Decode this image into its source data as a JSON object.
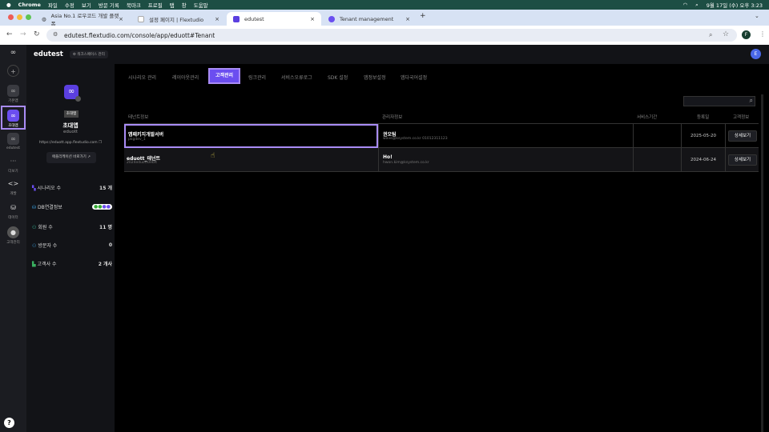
{
  "menubar": {
    "app": "Chrome",
    "items": [
      "파일",
      "수정",
      "보기",
      "방문 기록",
      "북마크",
      "프로필",
      "탭",
      "창",
      "도움말"
    ],
    "clock": "9월 17일 (수) 오후 3:23"
  },
  "tabs": [
    {
      "label": "Asia No.1 로우코드 개발 플랫폼"
    },
    {
      "label": "설정 페이지 | Flextudio"
    },
    {
      "label": "edutest",
      "active": true
    },
    {
      "label": "Tenant management"
    }
  ],
  "address": {
    "url": "edutest.flextudio.com/console/app/eduott#Tenant",
    "profile": "F"
  },
  "rail": {
    "items": [
      {
        "label": "기본앱"
      },
      {
        "label": "초대앱",
        "active": true
      },
      {
        "label": "edutest"
      },
      {
        "label": "더보기"
      },
      {
        "label": "개발"
      },
      {
        "label": "데이터"
      },
      {
        "label": "고객관리"
      }
    ],
    "help": "?"
  },
  "header": {
    "title": "edutest",
    "workspace": "워크스페이스 관리",
    "avatar": "E"
  },
  "app": {
    "badge": "초대앱",
    "name": "초대앱",
    "id": "eduott",
    "url": "https://eduott.app.flextudio.com",
    "open_button": "애플리케이션 바로가기"
  },
  "stats": [
    {
      "label": "시나리오 수",
      "value": "15 개"
    },
    {
      "label": "DB연결정보",
      "value": ""
    },
    {
      "label": "회원 수",
      "value": "11 명"
    },
    {
      "label": "방문자 수",
      "value": "0"
    },
    {
      "label": "고객사 수",
      "value": "2 개사"
    }
  ],
  "nav": [
    "시나리오 관리",
    "레이아웃관리",
    "고객관리",
    "링크관리",
    "서비스오류로그",
    "SDK 설정",
    "앱정보설정",
    "앱다국어설정"
  ],
  "nav_active": "고객관리",
  "table": {
    "headers": [
      "테넌트정보",
      "관리자정보",
      "서비스기간",
      "등록일",
      "고객정보"
    ],
    "rows": [
      {
        "name": "앱패키지개발서버",
        "code": "pkgdev_1",
        "admin": "권오팀",
        "contact": "wave@ksystem.co.kr 01012311123",
        "period": "",
        "date": "2025-05-20",
        "action": "상세보기"
      },
      {
        "name": "eduott_테넌트",
        "code": "2024eduott0ebft",
        "admin": "Ho!",
        "contact": "hwon.kim@ksystem.co.kr",
        "period": "",
        "date": "2024-06-24",
        "action": "상세보기"
      }
    ]
  },
  "colors": {
    "accent": "#6b4ef0",
    "highlight": "#a98cf5"
  }
}
